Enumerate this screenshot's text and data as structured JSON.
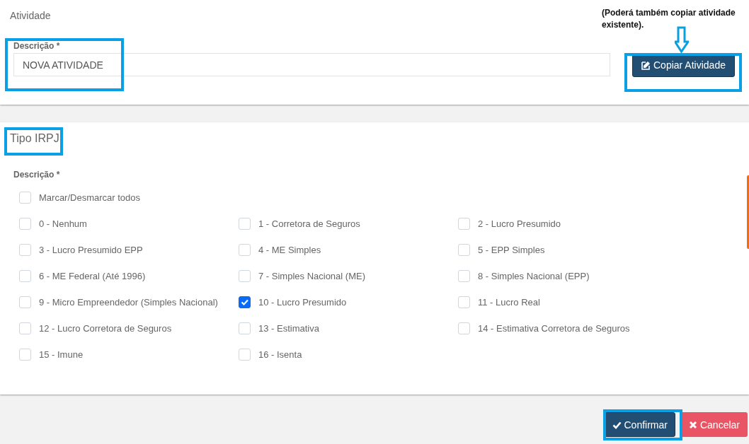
{
  "activity_card": {
    "title": "Atividade",
    "field_label": "Descrição *",
    "field_value": "NOVA ATIVIDADE",
    "copy_button": "Copiar Atividade"
  },
  "annotation": {
    "note": "(Poderá também copiar atividade existente)."
  },
  "irpj_card": {
    "title": "Tipo IRPJ",
    "field_label": "Descrição *",
    "select_all": {
      "label": "Marcar/Desmarcar todos",
      "checked": false
    },
    "options": [
      {
        "label": "0 - Nenhum",
        "checked": false
      },
      {
        "label": "1 - Corretora de Seguros",
        "checked": false
      },
      {
        "label": "2 - Lucro Presumido",
        "checked": false
      },
      {
        "label": "3 - Lucro Presumido EPP",
        "checked": false
      },
      {
        "label": "4 - ME Simples",
        "checked": false
      },
      {
        "label": "5 - EPP Simples",
        "checked": false
      },
      {
        "label": "6 - ME Federal (Até 1996)",
        "checked": false
      },
      {
        "label": "7 - Simples Nacional (ME)",
        "checked": false
      },
      {
        "label": "8 - Simples Nacional (EPP)",
        "checked": false
      },
      {
        "label": "9 - Micro Empreendedor (Simples Nacional)",
        "checked": false
      },
      {
        "label": "10 - Lucro Presumido",
        "checked": true
      },
      {
        "label": "11 - Lucro Real",
        "checked": false
      },
      {
        "label": "12 - Lucro Corretora de Seguros",
        "checked": false
      },
      {
        "label": "13 - Estimativa",
        "checked": false
      },
      {
        "label": "14 - Estimativa Corretora de Seguros",
        "checked": false
      },
      {
        "label": "15 - Imune",
        "checked": false
      },
      {
        "label": "16 - Isenta",
        "checked": false
      }
    ]
  },
  "footer": {
    "buttons": [
      {
        "kind": "confirm",
        "label": "Confirmar"
      },
      {
        "kind": "cancel",
        "label": "Cancelar"
      }
    ]
  }
}
